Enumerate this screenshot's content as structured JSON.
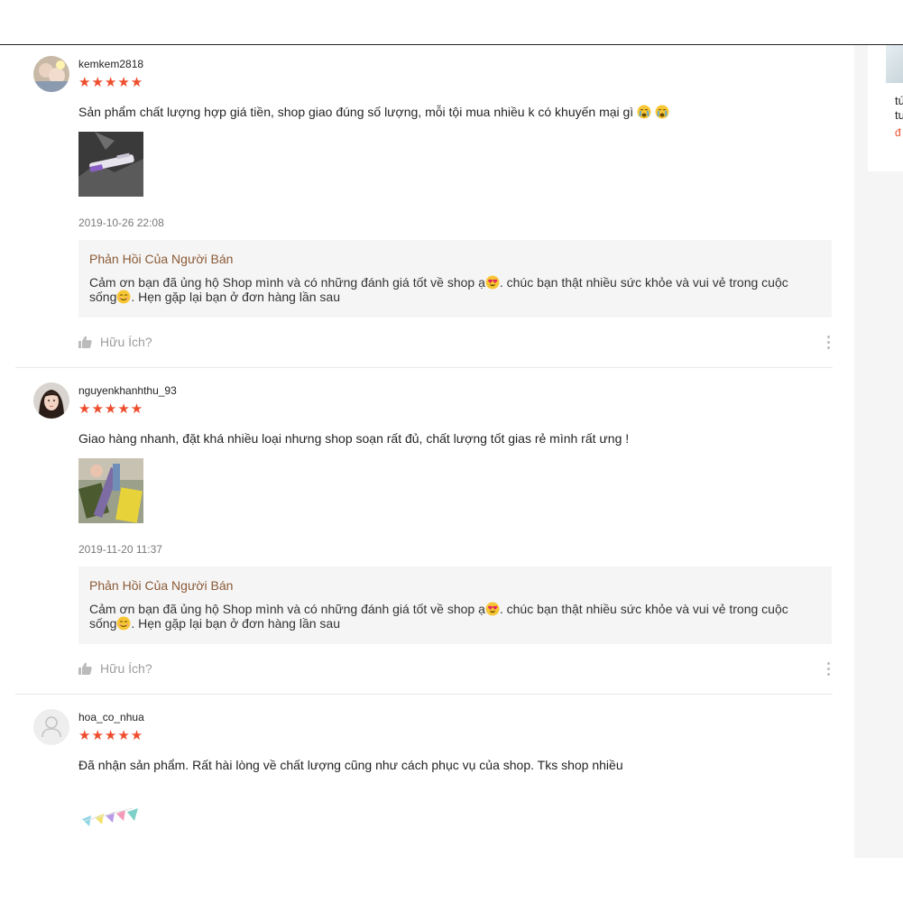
{
  "side_panel": {
    "line1": "tú",
    "line2": "tu",
    "link": "đ"
  },
  "reviews": [
    {
      "username": "kemkem2818",
      "stars": "★★★★★",
      "rating": 5,
      "comment": "Sản phẩm chất lượng hợp giá tiền, shop giao đúng số lượng, mỗi tội mua nhiều k có khuyến mại gì",
      "date": "2019-10-26 22:08",
      "reply_title": "Phản Hồi Của Người Bán",
      "reply_part1": "Cảm ơn bạn đã ủng hộ Shop mình và có những đánh giá tốt về shop ạ",
      "reply_part2": ". chúc bạn thật nhiều sức khỏe và vui vẻ trong cuộc sống",
      "reply_part3": ". Hẹn gặp lại bạn ở đơn hàng lần sau",
      "helpful_label": "Hữu Ích?"
    },
    {
      "username": "nguyenkhanhthu_93",
      "stars": "★★★★★",
      "rating": 5,
      "comment": "Giao hàng nhanh, đặt khá nhiều loại nhưng shop soạn rất đủ, chất lượng tốt gias rẻ mình rất ưng !",
      "date": "2019-11-20 11:37",
      "reply_title": "Phản Hồi Của Người Bán",
      "reply_part1": "Cảm ơn bạn đã ủng hộ Shop mình và có những đánh giá tốt về shop ạ",
      "reply_part2": ". chúc bạn thật nhiều sức khỏe và vui vẻ trong cuộc sống",
      "reply_part3": ". Hẹn gặp lại bạn ở đơn hàng lần sau",
      "helpful_label": "Hữu Ích?"
    },
    {
      "username": "hoa_co_nhua",
      "stars": "★★★★★",
      "rating": 5,
      "comment": "Đã nhận sản phẩm. Rất hài lòng về chất lượng cũng như cách phục vụ của shop. Tks shop nhiều"
    }
  ],
  "colors": {
    "accent": "#ee4d2d",
    "reply_title": "#8b5a36",
    "reply_bg": "#f5f5f5"
  },
  "icons": [
    "crying-face-icon",
    "heart-eyes-icon",
    "smile-icon",
    "thumbs-up-icon",
    "more-options-icon",
    "default-avatar-icon"
  ]
}
